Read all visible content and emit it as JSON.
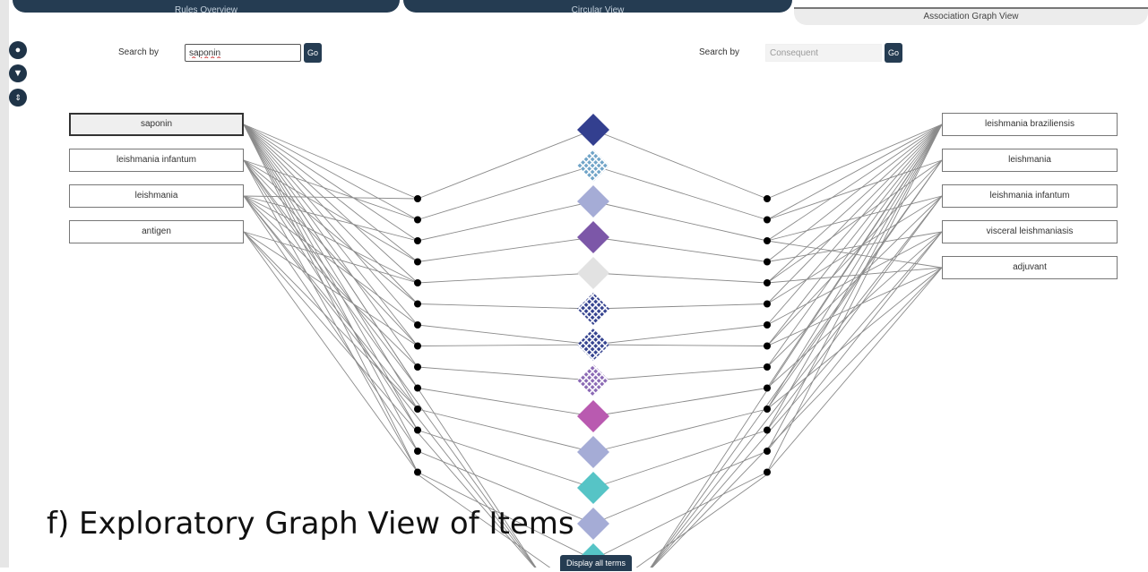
{
  "tabs": [
    {
      "label": "Rules Overview",
      "active": false
    },
    {
      "label": "Circular View",
      "active": false
    },
    {
      "label": "Association Graph View",
      "active": true
    }
  ],
  "sidebar_icons": [
    "palette-icon",
    "filter-icon",
    "sort-icon"
  ],
  "search_left": {
    "label": "Search by",
    "value": "saponin",
    "go_label": "Go"
  },
  "search_right": {
    "label": "Search by",
    "placeholder": "Consequent",
    "go_label": "Go"
  },
  "antecedents": [
    {
      "label": "saponin",
      "selected": true
    },
    {
      "label": "leishmania infantum",
      "selected": false
    },
    {
      "label": "leishmania",
      "selected": false
    },
    {
      "label": "antigen",
      "selected": false
    }
  ],
  "consequents": [
    {
      "label": "leishmania braziliensis"
    },
    {
      "label": "leishmania"
    },
    {
      "label": "leishmania infantum"
    },
    {
      "label": "visceral leishmaniasis"
    },
    {
      "label": "adjuvant"
    }
  ],
  "rule_diamonds": [
    {
      "color": "#333f8f",
      "pattern": false
    },
    {
      "color": "#6ea3c7",
      "pattern": true
    },
    {
      "color": "#a5acd6",
      "pattern": false
    },
    {
      "color": "#7c57a8",
      "pattern": false
    },
    {
      "color": "#e2e2e2",
      "pattern": false
    },
    {
      "color": "#34428f",
      "pattern": true
    },
    {
      "color": "#34428f",
      "pattern": true
    },
    {
      "color": "#8a68b4",
      "pattern": true
    },
    {
      "color": "#b95ab0",
      "pattern": false
    },
    {
      "color": "#a5acd6",
      "pattern": false
    },
    {
      "color": "#56c4c6",
      "pattern": false
    },
    {
      "color": "#a5acd6",
      "pattern": false
    },
    {
      "color": "#56c4c6",
      "pattern": false
    }
  ],
  "caption": "f) Exploratory Graph View of Items",
  "display_all_label": "Display all terms"
}
